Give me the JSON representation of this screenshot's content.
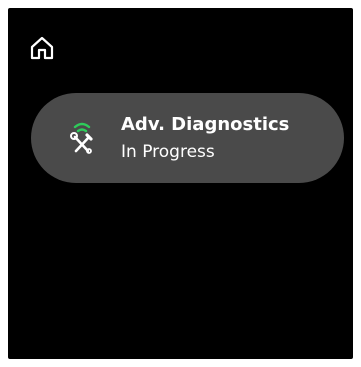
{
  "header": {
    "home_icon": "home-icon"
  },
  "status_card": {
    "icon": "tools-wifi-icon",
    "title": "Adv. Diagnostics",
    "subtitle": "In Progress"
  },
  "colors": {
    "screen_background": "#000000",
    "card_background": "#4a4a4a",
    "text": "#ffffff",
    "wifi_accent": "#2ecc5a"
  }
}
